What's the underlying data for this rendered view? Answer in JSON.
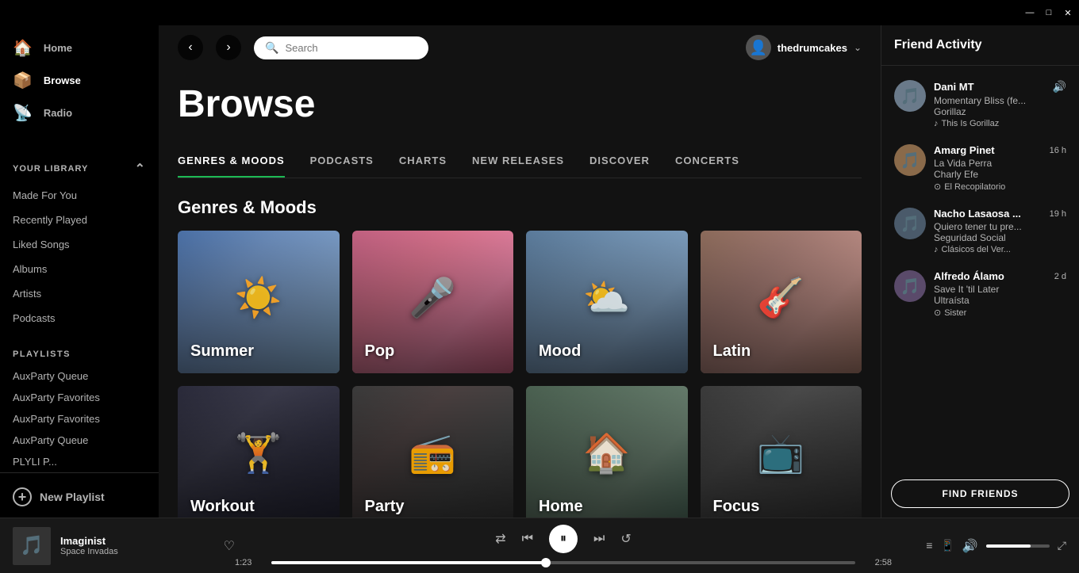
{
  "titlebar": {
    "minimize": "—",
    "maximize": "□",
    "close": "✕"
  },
  "sidebar": {
    "menu_dots": "• • •",
    "nav_items": [
      {
        "id": "home",
        "label": "Home",
        "icon": "🏠"
      },
      {
        "id": "browse",
        "label": "Browse",
        "icon": "📦",
        "active": true
      },
      {
        "id": "radio",
        "label": "Radio",
        "icon": "📡"
      }
    ],
    "library_title": "YOUR LIBRARY",
    "library_items": [
      {
        "id": "made-for-you",
        "label": "Made For You"
      },
      {
        "id": "recently-played",
        "label": "Recently Played"
      },
      {
        "id": "liked-songs",
        "label": "Liked Songs"
      },
      {
        "id": "albums",
        "label": "Albums"
      },
      {
        "id": "artists",
        "label": "Artists"
      },
      {
        "id": "podcasts",
        "label": "Podcasts"
      }
    ],
    "playlists_title": "PLAYLISTS",
    "playlists": [
      {
        "id": "auxparty-queue-1",
        "label": "AuxParty Queue"
      },
      {
        "id": "auxparty-favorites-1",
        "label": "AuxParty Favorites"
      },
      {
        "id": "auxparty-favorites-2",
        "label": "AuxParty Favorites"
      },
      {
        "id": "auxparty-queue-2",
        "label": "AuxParty Queue"
      },
      {
        "id": "playlist-p",
        "label": "PLYLI P..."
      }
    ],
    "new_playlist": "New Playlist"
  },
  "topbar": {
    "search_placeholder": "Search",
    "username": "thedrumcakes"
  },
  "browse": {
    "title": "Browse",
    "tabs": [
      {
        "id": "genres",
        "label": "GENRES & MOODS",
        "active": true
      },
      {
        "id": "podcasts",
        "label": "PODCASTS"
      },
      {
        "id": "charts",
        "label": "CHARTS"
      },
      {
        "id": "new-releases",
        "label": "NEW RELEASES"
      },
      {
        "id": "discover",
        "label": "DISCOVER"
      },
      {
        "id": "concerts",
        "label": "CONCERTS"
      }
    ],
    "section_title": "Genres & Moods",
    "genres": [
      {
        "id": "summer",
        "label": "Summer",
        "icon": "☀️",
        "color_class": "genre-summer"
      },
      {
        "id": "pop",
        "label": "Pop",
        "icon": "🎤",
        "color_class": "genre-pop"
      },
      {
        "id": "mood",
        "label": "Mood",
        "icon": "⛅",
        "color_class": "genre-mood"
      },
      {
        "id": "latin",
        "label": "Latin",
        "icon": "🎸",
        "color_class": "genre-latin"
      },
      {
        "id": "workout",
        "label": "Workout",
        "icon": "🏋️",
        "color_class": "genre-workout"
      },
      {
        "id": "party",
        "label": "Party",
        "icon": "📻",
        "color_class": "genre-party"
      },
      {
        "id": "home",
        "label": "Home",
        "icon": "🏠",
        "color_class": "genre-home"
      },
      {
        "id": "focus",
        "label": "Focus",
        "icon": "📺",
        "color_class": "genre-focus"
      }
    ]
  },
  "friends": {
    "title": "Friend Activity",
    "items": [
      {
        "id": "dani",
        "name": "Dani MT",
        "time": "",
        "song": "Momentary Bliss (fe...",
        "artist": "Gorillaz",
        "playlist": "This Is Gorillaz",
        "playlist_icon": "♪",
        "avatar_icon": "👤",
        "is_playing": true
      },
      {
        "id": "amarg",
        "name": "Amarg Pinet",
        "time": "16 h",
        "song": "La Vida Perra",
        "artist": "Charly Efe",
        "playlist": "El Recopilatorio",
        "playlist_icon": "⊙",
        "avatar_icon": "👤",
        "is_playing": false
      },
      {
        "id": "nacho",
        "name": "Nacho Lasaosa ...",
        "time": "19 h",
        "song": "Quiero tener tu pre...",
        "artist": "Seguridad Social",
        "playlist": "Clásicos del Ver...",
        "playlist_icon": "♪",
        "avatar_icon": "👤",
        "is_playing": false
      },
      {
        "id": "alfredo",
        "name": "Alfredo Álamo",
        "time": "2 d",
        "song": "Save It 'til Later",
        "artist": "Ultraísta",
        "playlist": "Sister",
        "playlist_icon": "⊙",
        "avatar_icon": "👤",
        "is_playing": false
      }
    ],
    "find_friends_btn": "FIND FRIENDS"
  },
  "player": {
    "track_name": "Imaginist",
    "artist": "Space Invadas",
    "current_time": "1:23",
    "total_time": "2:58",
    "progress_pct": 47,
    "volume_pct": 70
  }
}
